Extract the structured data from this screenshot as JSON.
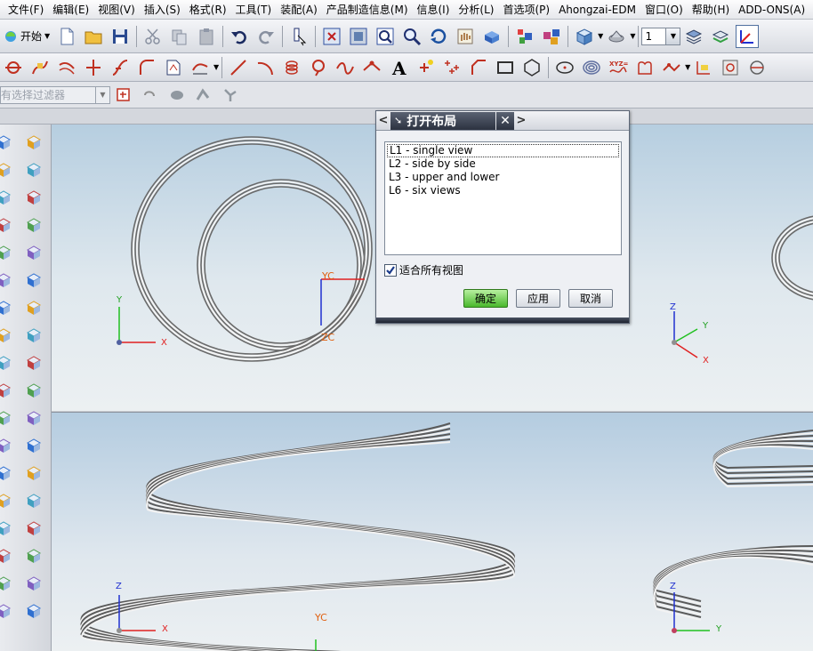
{
  "menu": {
    "items": [
      "文件(F)",
      "编辑(E)",
      "视图(V)",
      "插入(S)",
      "格式(R)",
      "工具(T)",
      "装配(A)",
      "产品制造信息(M)",
      "信息(I)",
      "分析(L)",
      "首选项(P)",
      "Ahongzai-EDM",
      "窗口(O)",
      "帮助(H)",
      "ADD-ONS(A)"
    ]
  },
  "toolbar": {
    "start_label": "开始",
    "layer_value": "1",
    "filter_placeholder": "有选择过滤器"
  },
  "dialog": {
    "title": "打开布局",
    "layouts": [
      "L1 - single view",
      "L2 - side by side",
      "L3 - upper and lower",
      "L6 - six views"
    ],
    "selected_index": 0,
    "fit_all_label": "适合所有视图",
    "fit_all_checked": true,
    "ok_label": "确定",
    "apply_label": "应用",
    "cancel_label": "取消"
  },
  "viewport_labels": {
    "yc": "YC",
    "zc": "ZC",
    "x": "X",
    "y": "Y",
    "z": "Z"
  },
  "colors": {
    "accent_green": "#49b82c",
    "axis_x": "#e02020",
    "axis_y": "#20c020",
    "axis_z": "#2030d0",
    "wcs_label": "#e06010"
  }
}
